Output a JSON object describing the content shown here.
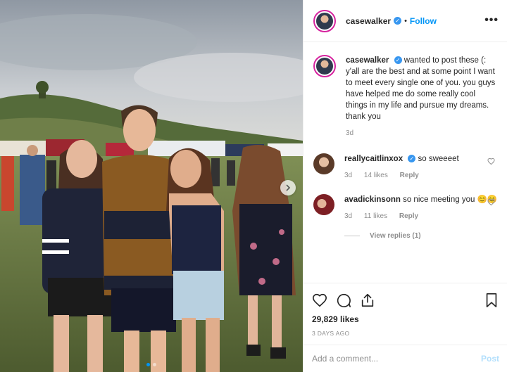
{
  "header": {
    "username": "casewalker",
    "verified_glyph": "✓",
    "separator": "•",
    "follow_label": "Follow",
    "more_label": "•••"
  },
  "caption": {
    "username": "casewalker",
    "text": "wanted to post these (: y'all are the best and at some point I want to meet every single one of you. you guys have helped me do some really cool things in my life and pursue my dreams. thank you",
    "age": "3d"
  },
  "comments": [
    {
      "username": "reallycaitlinxox",
      "verified": true,
      "text": "so sweeeet",
      "age": "3d",
      "likes": "14 likes",
      "reply_label": "Reply"
    },
    {
      "username": "avadickinsonn",
      "verified": false,
      "text": "so nice meeting you 😊😊",
      "age": "3d",
      "likes": "11 likes",
      "reply_label": "Reply",
      "view_replies": "View replies (1)"
    }
  ],
  "actions": {
    "icons": [
      "heart-icon",
      "comment-icon",
      "share-icon",
      "bookmark-icon"
    ],
    "likes_count": "29,829 likes",
    "date": "3 DAYS AGO"
  },
  "add_comment": {
    "placeholder": "Add a comment...",
    "post_label": "Post"
  },
  "carousel": {
    "total": 2,
    "active_index": 0
  },
  "colors": {
    "accent": "#0095f6",
    "verified": "#3897f0",
    "story_ring": "#d6249f",
    "muted": "#8e8e8e",
    "post_disabled": "#b2dffc"
  }
}
